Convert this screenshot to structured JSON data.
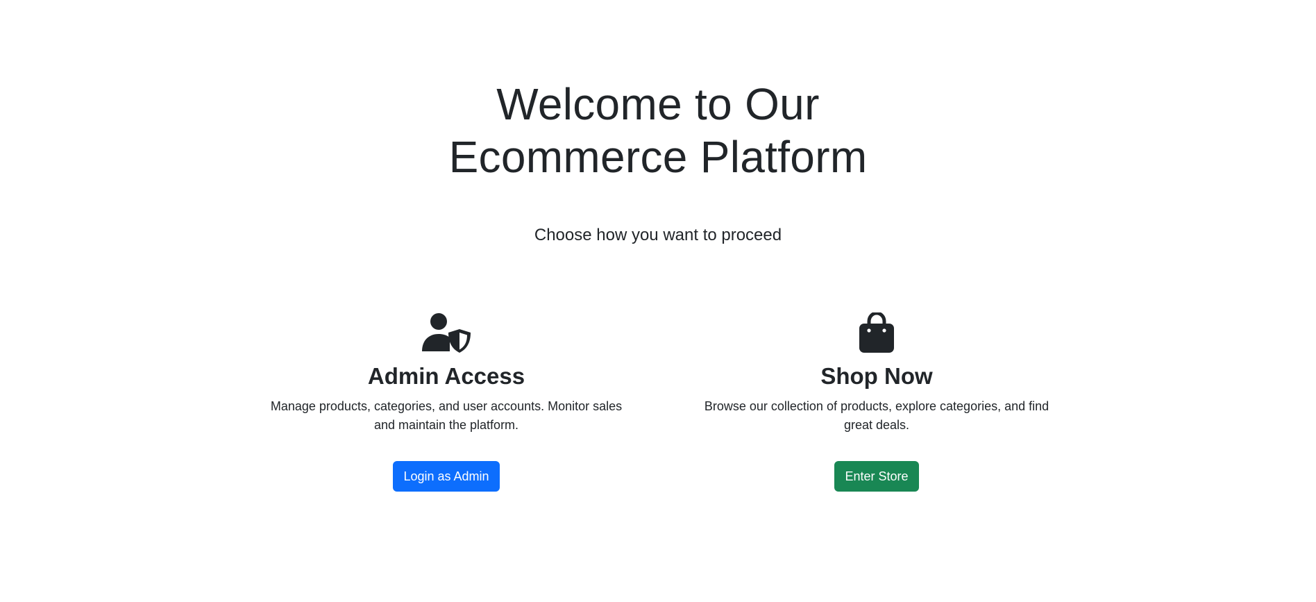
{
  "hero": {
    "title": "Welcome to Our Ecommerce Platform",
    "subtitle": "Choose how you want to proceed"
  },
  "admin": {
    "icon": "person-shield-icon",
    "title": "Admin Access",
    "description": "Manage products, categories, and user accounts. Monitor sales and maintain the platform.",
    "button_label": "Login as Admin",
    "button_color": "#0d6efd"
  },
  "shop": {
    "icon": "shopping-bag-icon",
    "title": "Shop Now",
    "description": "Browse our collection of products, explore categories, and find great deals.",
    "button_label": "Enter Store",
    "button_color": "#198754"
  },
  "colors": {
    "text": "#212529",
    "background": "#ffffff"
  }
}
